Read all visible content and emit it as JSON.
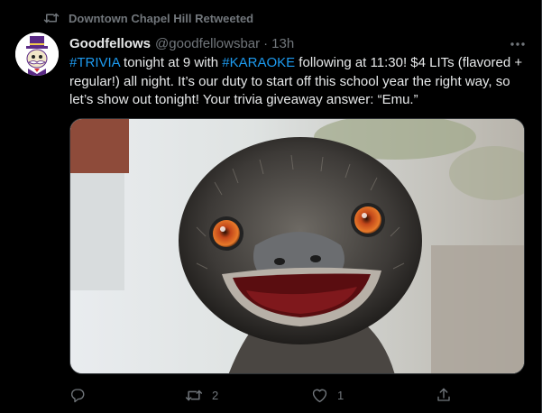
{
  "retweet_context": {
    "icon": "retweet-icon",
    "label": "Downtown Chapel Hill Retweeted"
  },
  "author": {
    "display_name": "Goodfellows",
    "handle": "@goodfellowsbar",
    "separator": "·",
    "time": "13h",
    "avatar": "top-hat-mascot-avatar"
  },
  "tweet": {
    "segments": [
      {
        "text": "#TRIVIA",
        "type": "hashtag"
      },
      {
        "text": " tonight at 9 with ",
        "type": "text"
      },
      {
        "text": "#KARAOKE",
        "type": "hashtag"
      },
      {
        "text": " following at 11:30! $4 LITs (flavored + regular!) all night. It’s our duty to start off this school year the right way, so let’s show out tonight! Your trivia giveaway answer: “Emu.”",
        "type": "text"
      }
    ]
  },
  "media": {
    "subject": "emu-photo"
  },
  "actions": {
    "reply": {
      "icon": "reply-icon",
      "count": ""
    },
    "retweet": {
      "icon": "retweet-icon",
      "count": "2"
    },
    "like": {
      "icon": "heart-icon",
      "count": "1"
    },
    "share": {
      "icon": "share-icon",
      "count": ""
    }
  },
  "colors": {
    "background": "#000000",
    "text_primary": "#e7e9ea",
    "text_secondary": "#71767b",
    "link": "#1d9bf0"
  }
}
